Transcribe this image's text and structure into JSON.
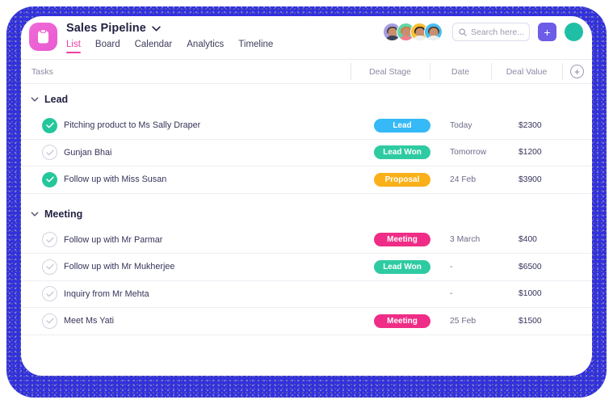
{
  "theme": {
    "frame_color": "#4a47e8",
    "accent_pink": "#ee3fa0",
    "app_icon_color": "#ee5bd0",
    "add_button_color": "#6c5ce7",
    "check_done_color": "#24c79b"
  },
  "header": {
    "app_icon": "clipboard-icon",
    "board_title": "Sales Pipeline",
    "title_chevron": "chevron-down-icon",
    "tabs": [
      {
        "label": "List",
        "active": true
      },
      {
        "label": "Board",
        "active": false
      },
      {
        "label": "Calendar",
        "active": false
      },
      {
        "label": "Analytics",
        "active": false
      },
      {
        "label": "Timeline",
        "active": false
      }
    ],
    "avatars": [
      {
        "name": "member-1",
        "bg": "#a79de0",
        "hair": "#3b3b3b",
        "body": "#3c4456"
      },
      {
        "name": "member-2",
        "bg": "#5fd6a4",
        "hair": "#c87b42",
        "body": "#ef7e8d"
      },
      {
        "name": "member-3",
        "bg": "#f7bf32",
        "hair": "#2c2118",
        "body": "#f0f0f0"
      },
      {
        "name": "member-4",
        "bg": "#49bdf0",
        "hair": "#4a3526",
        "body": "#eeeeee"
      }
    ],
    "search": {
      "icon": "search-icon",
      "placeholder": "Search here..."
    },
    "add_button_label": "+",
    "user_avatar": {
      "name": "current-user-avatar",
      "bg": "#1fbfa6",
      "hair": "#5e2a20",
      "body": "#d6453e"
    }
  },
  "columns": {
    "tasks_label": "Tasks",
    "deal_stage": "Deal Stage",
    "date": "Date",
    "deal_value": "Deal Value",
    "add_column_icon": "plus-circle-icon"
  },
  "groups": [
    {
      "name": "Lead",
      "chevron": "chevron-down-icon",
      "rows": [
        {
          "checked": true,
          "task": "Pitching product to Ms Sally Draper",
          "stage": "Lead",
          "stage_color": "#35b9f7",
          "date": "Today",
          "value": "$2300"
        },
        {
          "checked": false,
          "task": "Gunjan Bhai",
          "stage": "Lead Won",
          "stage_color": "#2ecba2",
          "date": "Tomorrow",
          "value": "$1200"
        },
        {
          "checked": true,
          "task": "Follow up with Miss Susan",
          "stage": "Proposal",
          "stage_color": "#f9b019",
          "date": "24 Feb",
          "value": "$3900"
        }
      ]
    },
    {
      "name": "Meeting",
      "chevron": "chevron-down-icon",
      "rows": [
        {
          "checked": false,
          "task": "Follow up with Mr Parmar",
          "stage": "Meeting",
          "stage_color": "#ef2d86",
          "date": "3 March",
          "value": "$400"
        },
        {
          "checked": false,
          "task": "Follow up with Mr Mukherjee",
          "stage": "Lead Won",
          "stage_color": "#2ecba2",
          "date": "-",
          "value": "$6500"
        },
        {
          "checked": false,
          "task": "Inquiry from Mr Mehta",
          "stage": "",
          "stage_color": "",
          "date": "-",
          "value": "$1000"
        },
        {
          "checked": false,
          "task": "Meet Ms Yati",
          "stage": "Meeting",
          "stage_color": "#ef2d86",
          "date": "25 Feb",
          "value": "$1500"
        }
      ]
    }
  ]
}
